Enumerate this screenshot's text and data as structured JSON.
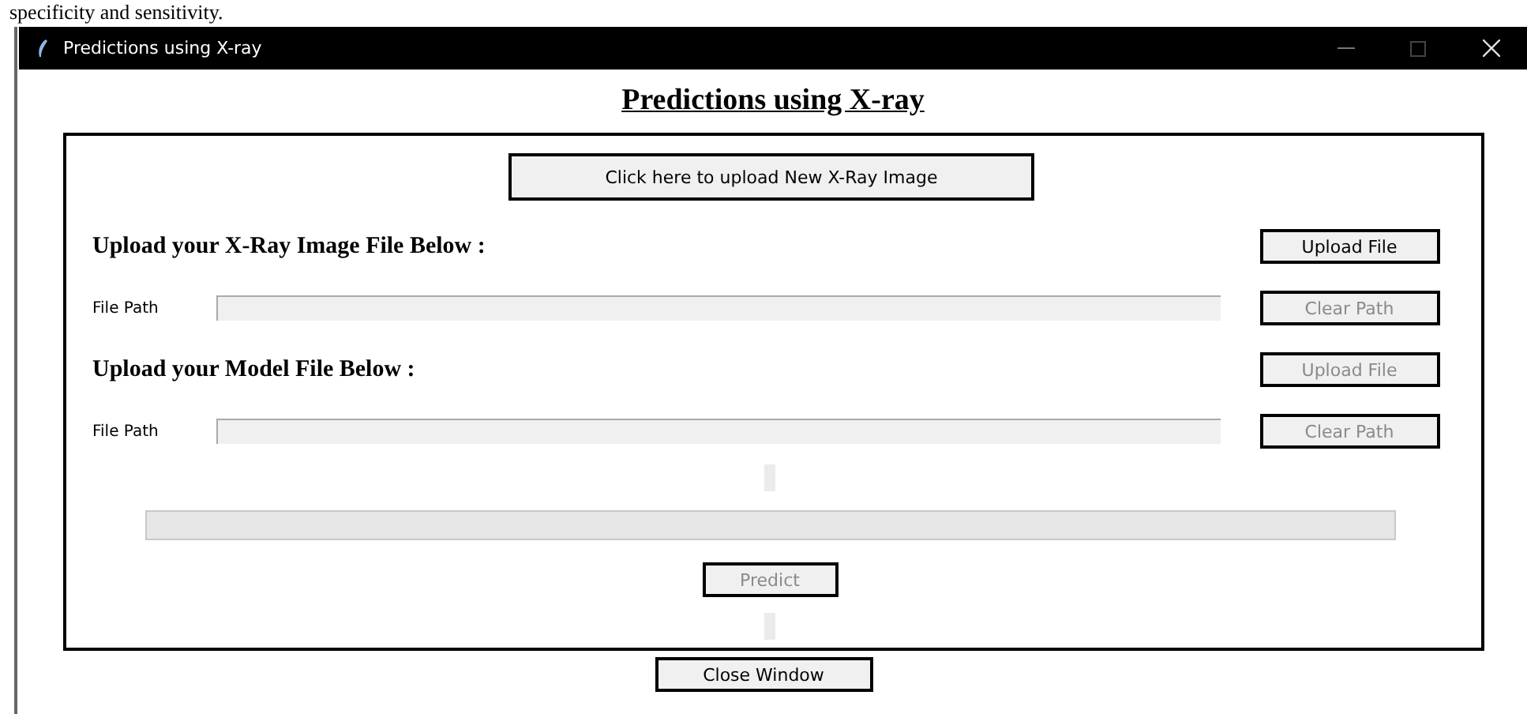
{
  "document_text": "specificity and sensitivity.",
  "window": {
    "title": "Predictions using X-ray"
  },
  "heading": "Predictions using X-ray",
  "upload_new_button": {
    "label": "Click here to upload New X-Ray Image",
    "disabled": false
  },
  "sections": [
    {
      "title": "Upload your X-Ray Image File Below :",
      "upload_button": {
        "label": "Upload File",
        "disabled": false
      },
      "path_label": "File Path",
      "clear_button": {
        "label": "Clear Path",
        "disabled": true
      }
    },
    {
      "title": "Upload your Model File Below :",
      "upload_button": {
        "label": "Upload File",
        "disabled": true
      },
      "path_label": "File Path",
      "clear_button": {
        "label": "Clear Path",
        "disabled": true
      }
    }
  ],
  "predict_button": {
    "label": "Predict",
    "disabled": true
  },
  "close_button": {
    "label": "Close Window",
    "disabled": false
  }
}
